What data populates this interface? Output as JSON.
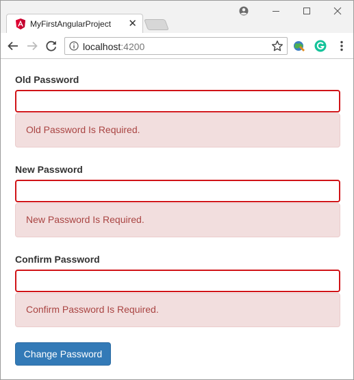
{
  "browser": {
    "tab_title": "MyFirstAngularProject",
    "tab_close_glyph": "✕",
    "url_host": "localhost",
    "url_port": ":4200",
    "colors": {
      "angular_red": "#dd0031",
      "grammarly_green": "#15c39a",
      "error_border": "#d01317"
    }
  },
  "form": {
    "old_password": {
      "label": "Old Password",
      "value": "",
      "error": "Old Password Is Required."
    },
    "new_password": {
      "label": "New Password",
      "value": "",
      "error": "New Password Is Required."
    },
    "confirm_password": {
      "label": "Confirm Password",
      "value": "",
      "error": "Confirm Password Is Required."
    },
    "submit_label": "Change Password",
    "colors": {
      "button": "#337ab7",
      "error_bg": "#f2dede",
      "error_text": "#a94442"
    }
  }
}
